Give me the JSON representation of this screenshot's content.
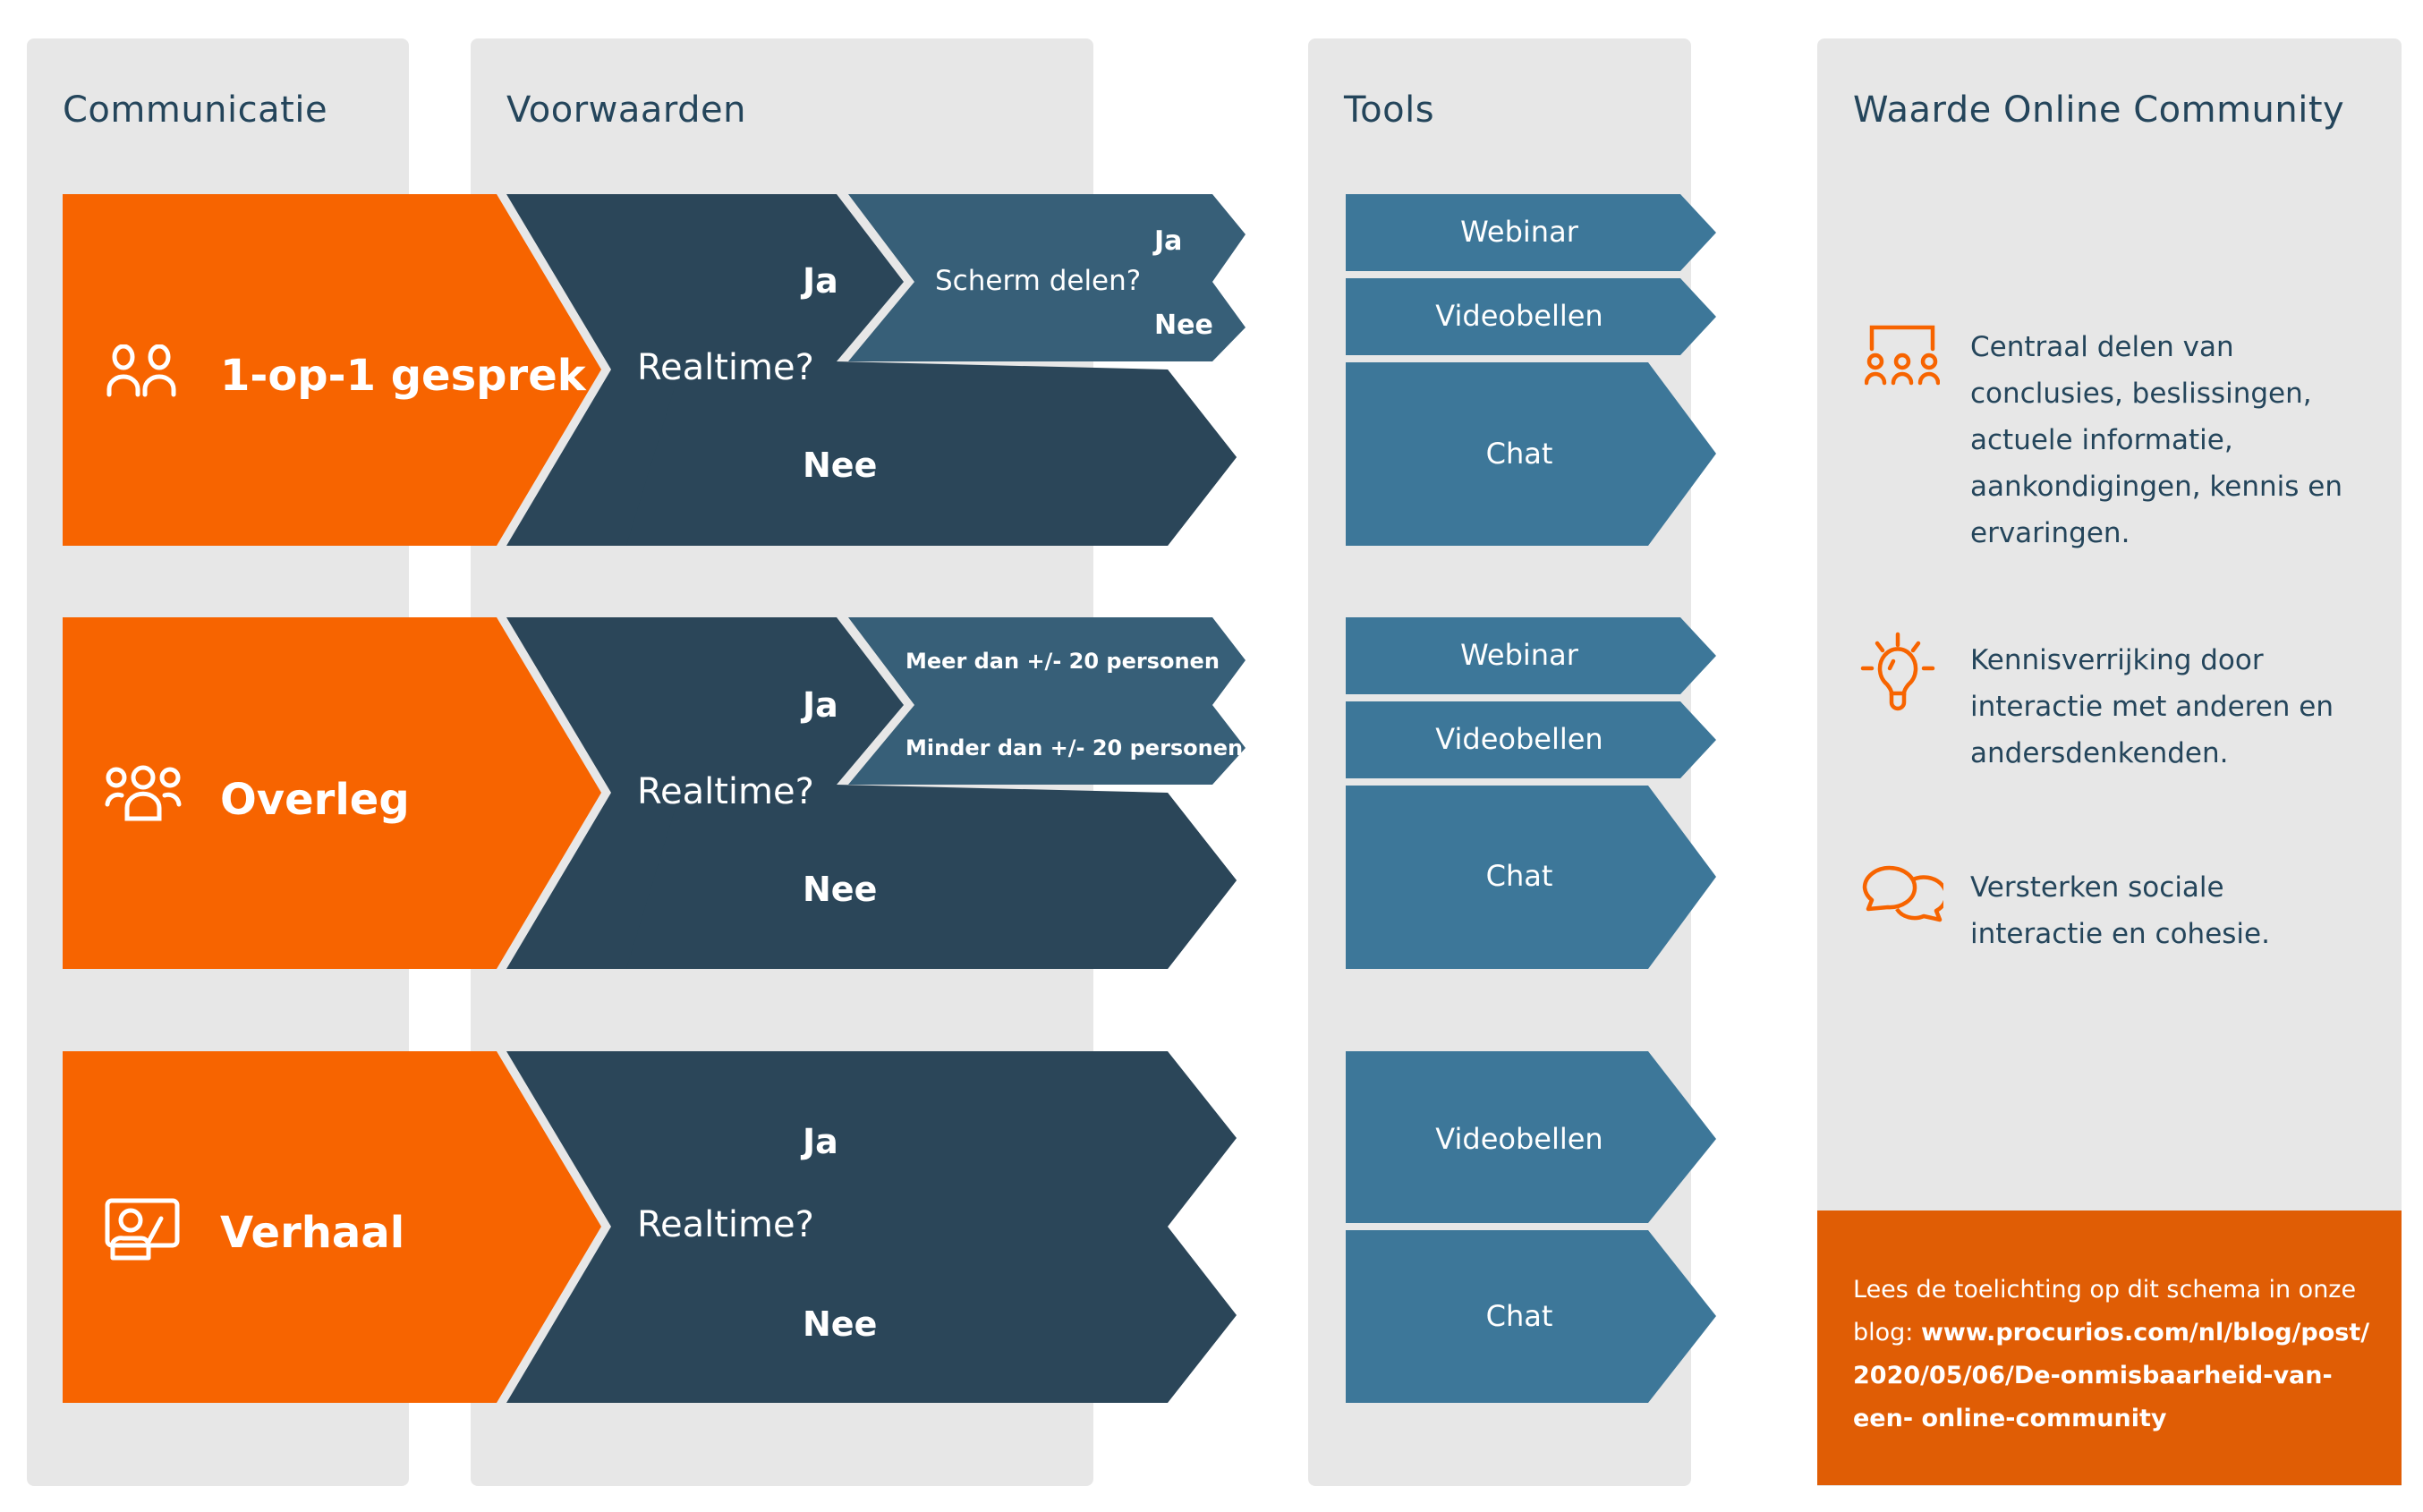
{
  "columns": {
    "communicatie": "Communicatie",
    "voorwaarden": "Voorwaarden",
    "tools": "Tools",
    "waarde": "Waarde Online Community"
  },
  "colors": {
    "orange": "#f76400",
    "dark_navy": "#2b4659",
    "slate_blue": "#375f78",
    "tool_blue": "#3d7799",
    "panel_grey": "#e7e7e7",
    "cta_orange": "#e05d05",
    "text_dark": "#24455b"
  },
  "rows": [
    {
      "type": "1-op-1 gesprek",
      "icon": "two-people-icon",
      "question": "Realtime?",
      "yes": "Ja",
      "no": "Nee",
      "sub_question": "Scherm delen?",
      "sub_options": [
        "Ja",
        "Nee"
      ],
      "tools": [
        "Webinar",
        "Videobellen",
        "Chat"
      ]
    },
    {
      "type": "Overleg",
      "icon": "group-icon",
      "question": "Realtime?",
      "yes": "Ja",
      "no": "Nee",
      "sub_question": "",
      "sub_options": [
        "Meer dan +/- 20 personen",
        "Minder dan +/- 20 personen"
      ],
      "tools": [
        "Webinar",
        "Videobellen",
        "Chat"
      ]
    },
    {
      "type": "Verhaal",
      "icon": "presenter-icon",
      "question": "Realtime?",
      "yes": "Ja",
      "no": "Nee",
      "tools": [
        "Videobellen",
        "Chat"
      ]
    }
  ],
  "benefits": [
    {
      "icon": "audience-icon",
      "text": "Centraal delen van conclusies, beslissingen, actuele informatie, aankondigingen, kennis en ervaringen."
    },
    {
      "icon": "lightbulb-icon",
      "text": "Kennisverrijking door interactie met anderen en andersdenkenden."
    },
    {
      "icon": "chat-bubbles-icon",
      "text": "Versterken sociale interactie en cohesie."
    }
  ],
  "cta": {
    "prefix": "Lees de toelichting op dit schema in onze blog: ",
    "link": "www.procurios.com/nl/blog/post/ 2020/05/06/De-onmisbaarheid-van-een- online-community"
  }
}
